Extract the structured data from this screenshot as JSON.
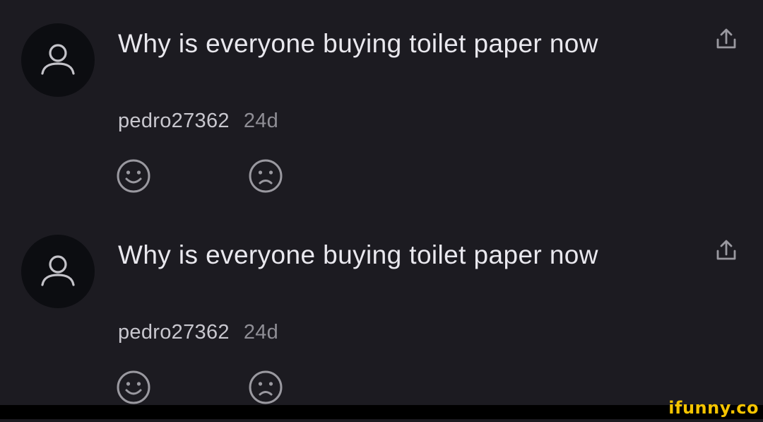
{
  "comments": [
    {
      "title": "Why is everyone buying toilet paper now",
      "author": "pedro27362",
      "age": "24d",
      "icons": {
        "avatar": "user-silhouette-icon",
        "share": "share-upload-icon",
        "like": "smile-face-icon",
        "dislike": "frown-face-icon"
      }
    },
    {
      "title": "Why is everyone buying toilet paper now",
      "author": "pedro27362",
      "age": "24d",
      "icons": {
        "avatar": "user-silhouette-icon",
        "share": "share-upload-icon",
        "like": "smile-face-icon",
        "dislike": "frown-face-icon"
      }
    }
  ],
  "watermark": "ifunny.co",
  "colors": {
    "background": "#1c1b21",
    "avatar_bg": "#0c0d11",
    "title": "#e9e8ee",
    "author": "#c8c7ce",
    "age": "#8f8e95",
    "icon": "#9a99a0",
    "watermark": "#f5c400"
  }
}
